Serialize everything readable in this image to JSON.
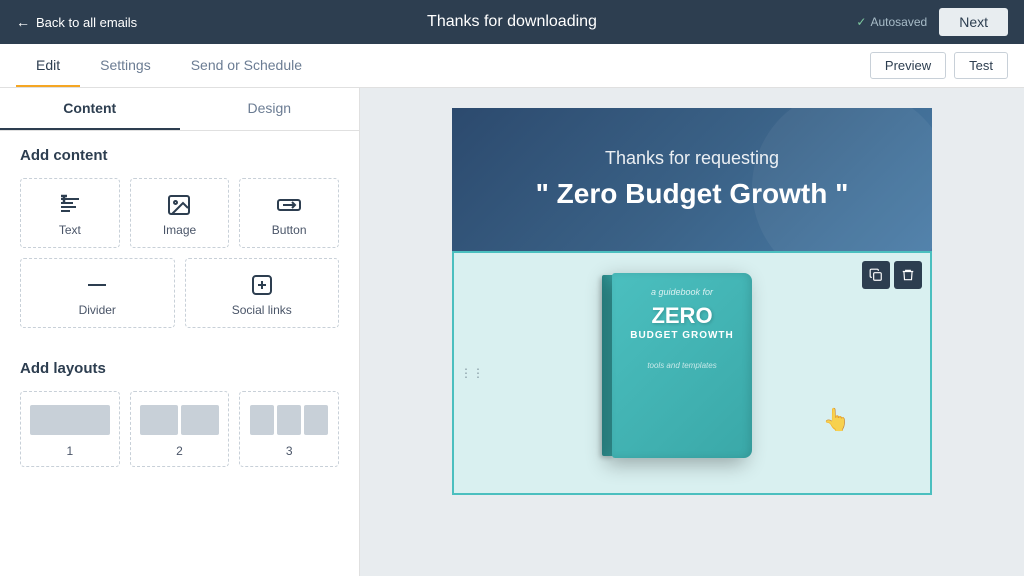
{
  "topBar": {
    "backLabel": "Back to all emails",
    "title": "Thanks for downloading",
    "autosavedLabel": "Autosaved",
    "nextLabel": "Next"
  },
  "tabs": {
    "items": [
      {
        "id": "edit",
        "label": "Edit",
        "active": true
      },
      {
        "id": "settings",
        "label": "Settings",
        "active": false
      },
      {
        "id": "send-schedule",
        "label": "Send or Schedule",
        "active": false
      }
    ],
    "previewLabel": "Preview",
    "testLabel": "Test"
  },
  "leftPanel": {
    "tabs": [
      {
        "id": "content",
        "label": "Content",
        "active": true
      },
      {
        "id": "design",
        "label": "Design",
        "active": false
      }
    ],
    "addContent": {
      "title": "Add content",
      "items": [
        {
          "id": "text",
          "label": "Text",
          "icon": "text-icon"
        },
        {
          "id": "image",
          "label": "Image",
          "icon": "image-icon"
        },
        {
          "id": "button",
          "label": "Button",
          "icon": "button-icon"
        },
        {
          "id": "divider",
          "label": "Divider",
          "icon": "divider-icon"
        },
        {
          "id": "social-links",
          "label": "Social links",
          "icon": "social-icon"
        }
      ]
    },
    "addLayouts": {
      "title": "Add layouts",
      "items": [
        {
          "id": "1",
          "label": "1",
          "cols": 1
        },
        {
          "id": "2",
          "label": "2",
          "cols": 2
        },
        {
          "id": "3",
          "label": "3",
          "cols": 3
        }
      ]
    }
  },
  "emailCanvas": {
    "hero": {
      "subtitle": "Thanks for requesting",
      "title": "\" Zero Budget Growth \""
    },
    "book": {
      "guidebookFor": "a guidebook for",
      "mainTitle": "ZERO",
      "subTitle": "BUDGET GROWTH",
      "footer": "tools and templates"
    }
  },
  "colors": {
    "darkNavy": "#2d3e50",
    "accent": "#f5a623",
    "teal": "#4bbfbf"
  }
}
